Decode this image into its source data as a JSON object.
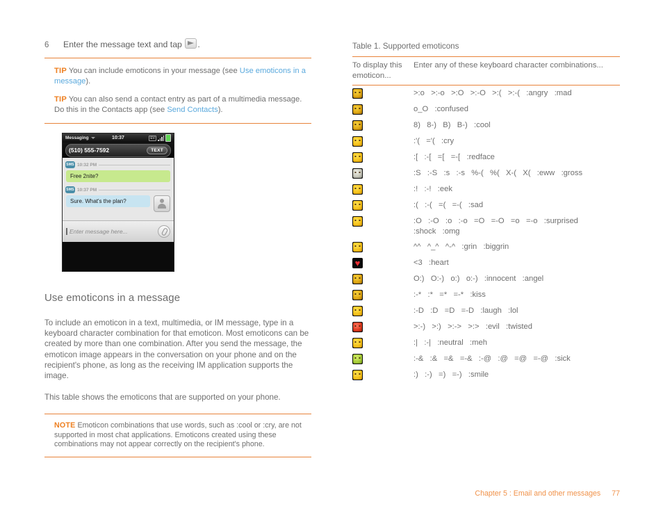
{
  "left": {
    "step": {
      "number": "6",
      "text_before": "Enter the message text and tap",
      "icon": "send-message-icon",
      "text_after": "."
    },
    "tips": [
      {
        "label": "TIP",
        "segments": [
          {
            "type": "text",
            "value": "You can include emoticons in your message (see "
          },
          {
            "type": "link",
            "value": "Use emoticons in a message"
          },
          {
            "type": "text",
            "value": ")."
          }
        ]
      },
      {
        "label": "TIP",
        "segments": [
          {
            "type": "text",
            "value": "You can also send a contact entry as part of a multimedia message. Do this in the Contacts app (see "
          },
          {
            "type": "link",
            "value": "Send Contacts"
          },
          {
            "type": "text",
            "value": ")."
          }
        ]
      }
    ],
    "phone": {
      "status": {
        "app": "Messaging",
        "clock": "10:37",
        "network": "EV",
        "signal_icon": "signal-bars-icon",
        "battery_icon": "battery-icon"
      },
      "header": {
        "contact": "(510) 555-7592",
        "mode_button": "TEXT"
      },
      "conversation": [
        {
          "badge": "SMS",
          "time": "10:32 PM",
          "bubble": "Free 2nite?",
          "style": "green",
          "avatar": false
        },
        {
          "badge": "SMS",
          "time": "10:37 PM",
          "bubble": "Sure. What's the plan?",
          "style": "blue",
          "avatar": true
        }
      ],
      "compose": {
        "placeholder": "Enter message here...",
        "attach_icon": "paperclip-icon"
      }
    },
    "heading": "Use emoticons in a message",
    "paragraphs": [
      "To include an emoticon in a text, multimedia, or IM message, type in a keyboard character combination for that emoticon. Most emoticons can be created by more than one combination. After you send the message, the emoticon image appears in the conversation on your phone and on the recipient's phone, as long as the receiving IM application supports the image.",
      "This table shows the emoticons that are supported on your phone."
    ],
    "note": {
      "label": "NOTE",
      "text": "Emoticon combinations that use words, such as :cool or :cry, are not supported in most chat applications. Emoticons created using these combinations may not appear correctly on the recipient's phone."
    }
  },
  "right": {
    "caption": "Table 1.  Supported emoticons",
    "headers": {
      "col1": "To display this emoticon...",
      "col2": "Enter any of these keyboard character combinations..."
    },
    "rows": [
      {
        "icon": "emoticon-angry-icon",
        "face": "angry",
        "combos": ">:o   >:-o   >:O   >:-O   >:(   >:-(   :angry   :mad"
      },
      {
        "icon": "emoticon-confused-icon",
        "face": "confused",
        "combos": "o_O   :confused"
      },
      {
        "icon": "emoticon-cool-icon",
        "face": "cool",
        "combos": "8)   8-)   B)   B-)   :cool"
      },
      {
        "icon": "emoticon-cry-icon",
        "face": "cry",
        "combos": ":'(   ='(   :cry"
      },
      {
        "icon": "emoticon-redface-icon",
        "face": "redface",
        "combos": ":[   :-[   =[   =-[   :redface"
      },
      {
        "icon": "emoticon-gross-icon",
        "face": "gross",
        "combos": ":S   :-S   :s   :-s   %-(   %(   X-(   X(   :eww   :gross"
      },
      {
        "icon": "emoticon-eek-icon",
        "face": "eek",
        "combos": ":!   :-!   :eek"
      },
      {
        "icon": "emoticon-sad-icon",
        "face": "sad",
        "combos": ":(   :-(   =(   =-(   :sad"
      },
      {
        "icon": "emoticon-surprised-icon",
        "face": "surprised",
        "combos": ":O   :-O   :o   :-o   =O   =-O   =o   =-o   :surprised\n:shock   :omg"
      },
      {
        "icon": "emoticon-grin-icon",
        "face": "grin",
        "combos": "^^   ^_^   ^-^   :grin   :biggrin"
      },
      {
        "icon": "emoticon-heart-icon",
        "face": "heart",
        "combos": "<3   :heart"
      },
      {
        "icon": "emoticon-innocent-icon",
        "face": "innocent",
        "combos": "O:)   O:-)   o:)   o:-)   :innocent   :angel"
      },
      {
        "icon": "emoticon-kiss-icon",
        "face": "kiss",
        "combos": ":-*   :*   =*   =-*   :kiss"
      },
      {
        "icon": "emoticon-laugh-icon",
        "face": "laugh",
        "combos": ":-D   :D   =D   =-D   :laugh   :lol"
      },
      {
        "icon": "emoticon-evil-icon",
        "face": "evil",
        "combos": ">:-)   >:)   >:->   >:>   :evil   :twisted"
      },
      {
        "icon": "emoticon-neutral-icon",
        "face": "neutral",
        "combos": ":|   :-|   :neutral   :meh"
      },
      {
        "icon": "emoticon-sick-icon",
        "face": "sick",
        "combos": ":-&   :&   =&   =-&   :-@   :@   =@   =-@   :sick"
      },
      {
        "icon": "emoticon-smile-icon",
        "face": "smile",
        "combos": ":)   :-)   =)   =-)   :smile"
      }
    ]
  },
  "footer": {
    "chapter": "Chapter 5  :  Email and other messages",
    "page": "77"
  },
  "colors": {
    "accent": "#e8833a",
    "tip_label": "#ee8022",
    "link": "#5aa9dd",
    "body_text": "#6f6f6f",
    "footer": "#f0924a"
  }
}
